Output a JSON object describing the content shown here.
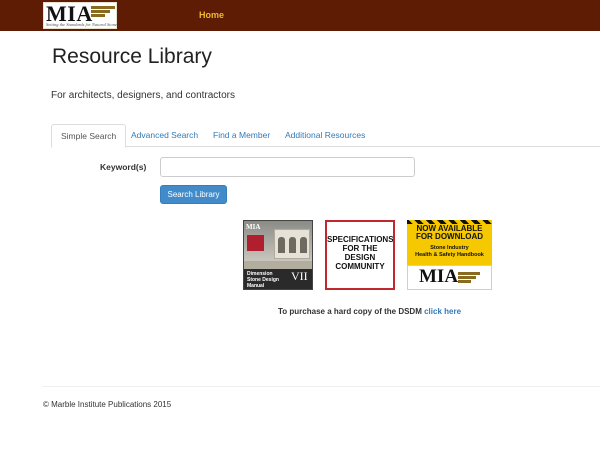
{
  "navbar": {
    "logo_text": "MIA",
    "logo_tagline": "Setting the Standards for Natural Stone",
    "home_label": "Home",
    "background_color": "#5e1c04",
    "home_color": "#f0b830"
  },
  "page": {
    "title": "Resource Library",
    "subtitle": "For architects, designers, and contractors"
  },
  "tabs": [
    {
      "label": "Simple Search",
      "active": true
    },
    {
      "label": "Advanced Search",
      "active": false
    },
    {
      "label": "Find a Member",
      "active": false
    },
    {
      "label": "Additional Resources",
      "active": false
    }
  ],
  "search": {
    "keyword_label": "Keyword(s)",
    "keyword_value": "",
    "button_label": "Search Library"
  },
  "thumbnails": {
    "dsdm": {
      "logo": "MIA",
      "title": "Dimension Stone Design Manual",
      "volume": "VII"
    },
    "specifications": {
      "line1": "SPECIFICATIONS",
      "line2": "FOR THE",
      "line3": "DESIGN",
      "line4": "COMMUNITY"
    },
    "handbook": {
      "line1": "NOW AVAILABLE",
      "line2": "FOR DOWNLOAD",
      "sub1": "Stone Industry",
      "sub2": "Health & Safety Handbook",
      "logo": "MIA"
    }
  },
  "purchase": {
    "text": "To purchase a hard copy of the DSDM",
    "link_label": "click here"
  },
  "footer": {
    "copyright": "© Marble Institute Publications 2015"
  }
}
